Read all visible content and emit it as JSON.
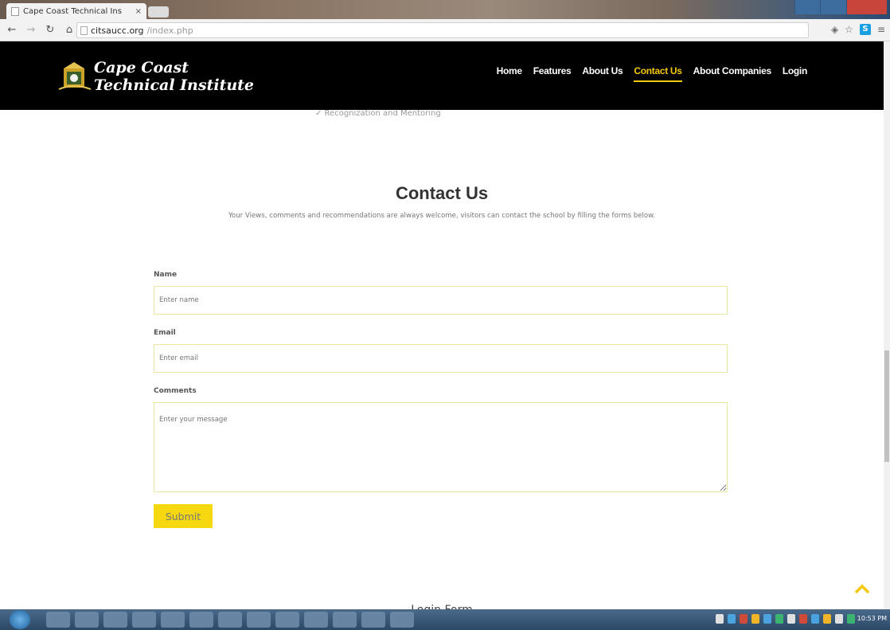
{
  "browser": {
    "tab_title": "Cape Coast Technical Ins",
    "tab_close": "×",
    "url_host": "citsaucc.org",
    "url_path": "/index.php"
  },
  "site": {
    "brand_line1": "Cape Coast",
    "brand_line2": "Technical Institute",
    "nav": [
      {
        "label": "Home"
      },
      {
        "label": "Features"
      },
      {
        "label": "About Us"
      },
      {
        "label": "Contact Us"
      },
      {
        "label": "About Companies"
      },
      {
        "label": "Login"
      }
    ],
    "active_nav": "Contact Us",
    "accent_color": "#f5c90a"
  },
  "page": {
    "cutoff_text": "✓ Recognization and Mentoring",
    "contact_title": "Contact Us",
    "contact_subtitle": "Your Views, comments and recommendations are always welcome, visitors can contact the school by filling the forms below.",
    "form": {
      "name_label": "Name",
      "name_placeholder": "Enter name",
      "email_label": "Email",
      "email_placeholder": "Enter email",
      "comments_label": "Comments",
      "comments_placeholder": "Enter your message",
      "submit_label": "Submit"
    },
    "next_section_title": "Login Form"
  },
  "taskbar": {
    "clock": "10:53 PM"
  }
}
